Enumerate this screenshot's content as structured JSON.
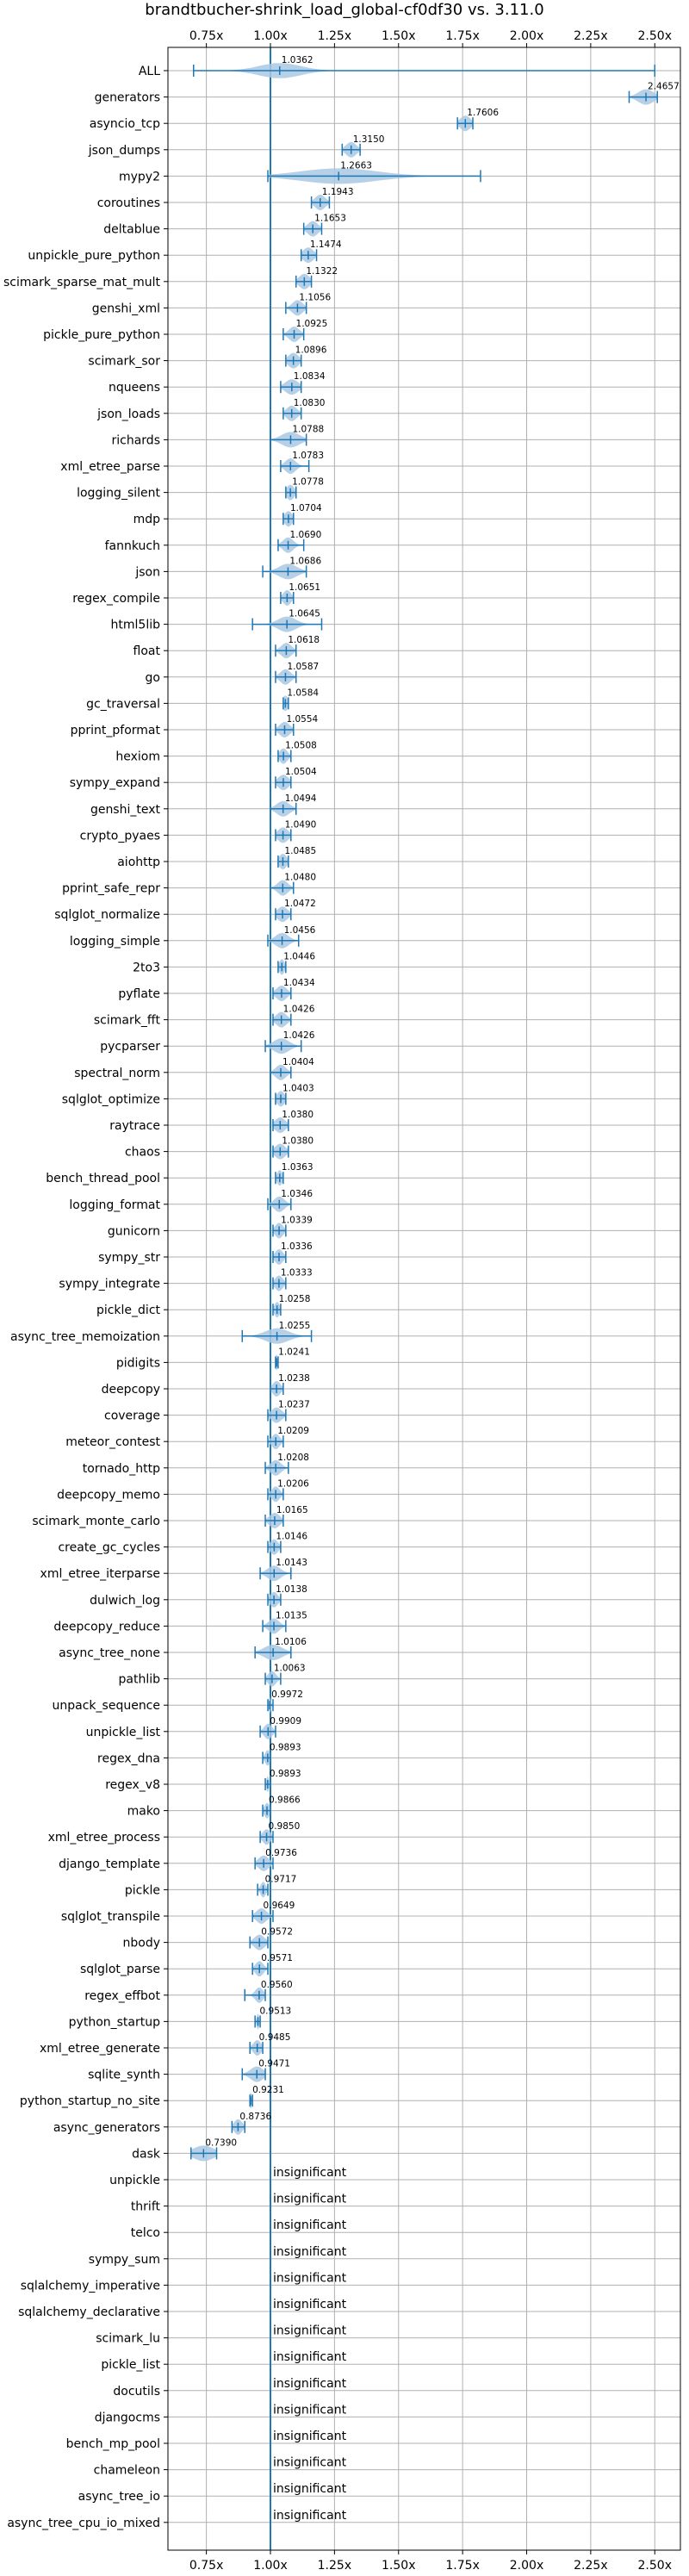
{
  "chart_data": {
    "type": "violin",
    "title": "brandtbucher-shrink_load_global-cf0df30 vs. 3.11.0",
    "xlabel": "",
    "ylabel": "",
    "xlim": [
      0.6,
      2.6
    ],
    "reference_x": 1.0,
    "xticks": [
      0.75,
      1.0,
      1.25,
      1.5,
      1.75,
      2.0,
      2.25,
      2.5
    ],
    "xtick_labels": [
      "0.75x",
      "1.00x",
      "1.25x",
      "1.50x",
      "1.75x",
      "2.00x",
      "2.25x",
      "2.50x"
    ],
    "grid": true,
    "colors": {
      "line": "#1f77b4",
      "violin": "#a9c9e3",
      "grid": "#b0b0b0"
    },
    "rows": [
      {
        "name": "ALL",
        "value": 1.0362,
        "value_label": "1.0362",
        "min": 0.7,
        "max": 2.5,
        "spread": 0.08
      },
      {
        "name": "generators",
        "value": 2.4657,
        "value_label": "2.4657",
        "min": 2.4,
        "max": 2.51,
        "spread": 0.03
      },
      {
        "name": "asyncio_tcp",
        "value": 1.7606,
        "value_label": "1.7606",
        "min": 1.73,
        "max": 1.79,
        "spread": 0.02
      },
      {
        "name": "json_dumps",
        "value": 1.315,
        "value_label": "1.3150",
        "min": 1.28,
        "max": 1.35,
        "spread": 0.02
      },
      {
        "name": "mypy2",
        "value": 1.2663,
        "value_label": "1.2663",
        "min": 0.99,
        "max": 1.82,
        "spread": 0.15
      },
      {
        "name": "coroutines",
        "value": 1.1943,
        "value_label": "1.1943",
        "min": 1.16,
        "max": 1.23,
        "spread": 0.02
      },
      {
        "name": "deltablue",
        "value": 1.1653,
        "value_label": "1.1653",
        "min": 1.13,
        "max": 1.2,
        "spread": 0.02
      },
      {
        "name": "unpickle_pure_python",
        "value": 1.1474,
        "value_label": "1.1474",
        "min": 1.12,
        "max": 1.18,
        "spread": 0.02
      },
      {
        "name": "scimark_sparse_mat_mult",
        "value": 1.1322,
        "value_label": "1.1322",
        "min": 1.1,
        "max": 1.16,
        "spread": 0.02
      },
      {
        "name": "genshi_xml",
        "value": 1.1056,
        "value_label": "1.1056",
        "min": 1.06,
        "max": 1.14,
        "spread": 0.02
      },
      {
        "name": "pickle_pure_python",
        "value": 1.0925,
        "value_label": "1.0925",
        "min": 1.05,
        "max": 1.13,
        "spread": 0.02
      },
      {
        "name": "scimark_sor",
        "value": 1.0896,
        "value_label": "1.0896",
        "min": 1.06,
        "max": 1.12,
        "spread": 0.02
      },
      {
        "name": "nqueens",
        "value": 1.0834,
        "value_label": "1.0834",
        "min": 1.04,
        "max": 1.12,
        "spread": 0.025
      },
      {
        "name": "json_loads",
        "value": 1.083,
        "value_label": "1.0830",
        "min": 1.05,
        "max": 1.12,
        "spread": 0.02
      },
      {
        "name": "richards",
        "value": 1.0788,
        "value_label": "1.0788",
        "min": 1.0,
        "max": 1.14,
        "spread": 0.035
      },
      {
        "name": "xml_etree_parse",
        "value": 1.0783,
        "value_label": "1.0783",
        "min": 1.04,
        "max": 1.15,
        "spread": 0.02
      },
      {
        "name": "logging_silent",
        "value": 1.0778,
        "value_label": "1.0778",
        "min": 1.06,
        "max": 1.1,
        "spread": 0.015
      },
      {
        "name": "mdp",
        "value": 1.0704,
        "value_label": "1.0704",
        "min": 1.05,
        "max": 1.09,
        "spread": 0.015
      },
      {
        "name": "fannkuch",
        "value": 1.069,
        "value_label": "1.0690",
        "min": 1.03,
        "max": 1.13,
        "spread": 0.02
      },
      {
        "name": "json",
        "value": 1.0686,
        "value_label": "1.0686",
        "min": 0.97,
        "max": 1.14,
        "spread": 0.035
      },
      {
        "name": "regex_compile",
        "value": 1.0651,
        "value_label": "1.0651",
        "min": 1.04,
        "max": 1.09,
        "spread": 0.015
      },
      {
        "name": "html5lib",
        "value": 1.0645,
        "value_label": "1.0645",
        "min": 0.93,
        "max": 1.2,
        "spread": 0.035
      },
      {
        "name": "float",
        "value": 1.0618,
        "value_label": "1.0618",
        "min": 1.02,
        "max": 1.1,
        "spread": 0.02
      },
      {
        "name": "go",
        "value": 1.0587,
        "value_label": "1.0587",
        "min": 1.02,
        "max": 1.1,
        "spread": 0.02
      },
      {
        "name": "gc_traversal",
        "value": 1.0584,
        "value_label": "1.0584",
        "min": 1.05,
        "max": 1.07,
        "spread": 0.01
      },
      {
        "name": "pprint_pformat",
        "value": 1.0554,
        "value_label": "1.0554",
        "min": 1.02,
        "max": 1.09,
        "spread": 0.02
      },
      {
        "name": "hexiom",
        "value": 1.0508,
        "value_label": "1.0508",
        "min": 1.03,
        "max": 1.08,
        "spread": 0.015
      },
      {
        "name": "sympy_expand",
        "value": 1.0504,
        "value_label": "1.0504",
        "min": 1.02,
        "max": 1.08,
        "spread": 0.02
      },
      {
        "name": "genshi_text",
        "value": 1.0494,
        "value_label": "1.0494",
        "min": 1.0,
        "max": 1.1,
        "spread": 0.025
      },
      {
        "name": "crypto_pyaes",
        "value": 1.049,
        "value_label": "1.0490",
        "min": 1.02,
        "max": 1.08,
        "spread": 0.02
      },
      {
        "name": "aiohttp",
        "value": 1.0485,
        "value_label": "1.0485",
        "min": 1.03,
        "max": 1.07,
        "spread": 0.015
      },
      {
        "name": "pprint_safe_repr",
        "value": 1.048,
        "value_label": "1.0480",
        "min": 1.0,
        "max": 1.09,
        "spread": 0.02
      },
      {
        "name": "sqlglot_normalize",
        "value": 1.0472,
        "value_label": "1.0472",
        "min": 1.02,
        "max": 1.08,
        "spread": 0.02
      },
      {
        "name": "logging_simple",
        "value": 1.0456,
        "value_label": "1.0456",
        "min": 0.99,
        "max": 1.11,
        "spread": 0.025
      },
      {
        "name": "2to3",
        "value": 1.0446,
        "value_label": "1.0446",
        "min": 1.03,
        "max": 1.06,
        "spread": 0.01
      },
      {
        "name": "pyflate",
        "value": 1.0434,
        "value_label": "1.0434",
        "min": 1.01,
        "max": 1.08,
        "spread": 0.02
      },
      {
        "name": "scimark_fft",
        "value": 1.0426,
        "value_label": "1.0426",
        "min": 1.01,
        "max": 1.08,
        "spread": 0.02
      },
      {
        "name": "pycparser",
        "value": 1.0426,
        "value_label": "1.0426",
        "min": 0.98,
        "max": 1.12,
        "spread": 0.03
      },
      {
        "name": "spectral_norm",
        "value": 1.0404,
        "value_label": "1.0404",
        "min": 1.0,
        "max": 1.08,
        "spread": 0.02
      },
      {
        "name": "sqlglot_optimize",
        "value": 1.0403,
        "value_label": "1.0403",
        "min": 1.02,
        "max": 1.06,
        "spread": 0.015
      },
      {
        "name": "raytrace",
        "value": 1.038,
        "value_label": "1.0380",
        "min": 1.01,
        "max": 1.07,
        "spread": 0.02
      },
      {
        "name": "chaos",
        "value": 1.038,
        "value_label": "1.0380",
        "min": 1.01,
        "max": 1.07,
        "spread": 0.02
      },
      {
        "name": "bench_thread_pool",
        "value": 1.0363,
        "value_label": "1.0363",
        "min": 1.02,
        "max": 1.05,
        "spread": 0.01
      },
      {
        "name": "logging_format",
        "value": 1.0346,
        "value_label": "1.0346",
        "min": 0.99,
        "max": 1.08,
        "spread": 0.02
      },
      {
        "name": "gunicorn",
        "value": 1.0339,
        "value_label": "1.0339",
        "min": 1.01,
        "max": 1.06,
        "spread": 0.015
      },
      {
        "name": "sympy_str",
        "value": 1.0336,
        "value_label": "1.0336",
        "min": 1.01,
        "max": 1.06,
        "spread": 0.015
      },
      {
        "name": "sympy_integrate",
        "value": 1.0333,
        "value_label": "1.0333",
        "min": 1.01,
        "max": 1.06,
        "spread": 0.015
      },
      {
        "name": "pickle_dict",
        "value": 1.0258,
        "value_label": "1.0258",
        "min": 1.01,
        "max": 1.04,
        "spread": 0.01
      },
      {
        "name": "async_tree_memoization",
        "value": 1.0255,
        "value_label": "1.0255",
        "min": 0.89,
        "max": 1.16,
        "spread": 0.045
      },
      {
        "name": "pidigits",
        "value": 1.0241,
        "value_label": "1.0241",
        "min": 1.02,
        "max": 1.03,
        "spread": 0.005
      },
      {
        "name": "deepcopy",
        "value": 1.0238,
        "value_label": "1.0238",
        "min": 1.0,
        "max": 1.05,
        "spread": 0.015
      },
      {
        "name": "coverage",
        "value": 1.0237,
        "value_label": "1.0237",
        "min": 0.99,
        "max": 1.06,
        "spread": 0.02
      },
      {
        "name": "meteor_contest",
        "value": 1.0209,
        "value_label": "1.0209",
        "min": 0.99,
        "max": 1.05,
        "spread": 0.015
      },
      {
        "name": "tornado_http",
        "value": 1.0208,
        "value_label": "1.0208",
        "min": 0.98,
        "max": 1.07,
        "spread": 0.02
      },
      {
        "name": "deepcopy_memo",
        "value": 1.0206,
        "value_label": "1.0206",
        "min": 0.99,
        "max": 1.05,
        "spread": 0.015
      },
      {
        "name": "scimark_monte_carlo",
        "value": 1.0165,
        "value_label": "1.0165",
        "min": 0.98,
        "max": 1.05,
        "spread": 0.02
      },
      {
        "name": "create_gc_cycles",
        "value": 1.0146,
        "value_label": "1.0146",
        "min": 0.99,
        "max": 1.04,
        "spread": 0.015
      },
      {
        "name": "xml_etree_iterparse",
        "value": 1.0143,
        "value_label": "1.0143",
        "min": 0.96,
        "max": 1.08,
        "spread": 0.025
      },
      {
        "name": "dulwich_log",
        "value": 1.0138,
        "value_label": "1.0138",
        "min": 0.99,
        "max": 1.04,
        "spread": 0.015
      },
      {
        "name": "deepcopy_reduce",
        "value": 1.0135,
        "value_label": "1.0135",
        "min": 0.97,
        "max": 1.06,
        "spread": 0.02
      },
      {
        "name": "async_tree_none",
        "value": 1.0106,
        "value_label": "1.0106",
        "min": 0.94,
        "max": 1.08,
        "spread": 0.035
      },
      {
        "name": "pathlib",
        "value": 1.0063,
        "value_label": "1.0063",
        "min": 0.98,
        "max": 1.04,
        "spread": 0.015
      },
      {
        "name": "unpack_sequence",
        "value": 0.9972,
        "value_label": "0.9972",
        "min": 0.99,
        "max": 1.01,
        "spread": 0.005
      },
      {
        "name": "unpickle_list",
        "value": 0.9909,
        "value_label": "0.9909",
        "min": 0.96,
        "max": 1.02,
        "spread": 0.015
      },
      {
        "name": "regex_dna",
        "value": 0.9893,
        "value_label": "0.9893",
        "min": 0.97,
        "max": 1.0,
        "spread": 0.01
      },
      {
        "name": "regex_v8",
        "value": 0.9893,
        "value_label": "0.9893",
        "min": 0.98,
        "max": 1.0,
        "spread": 0.005
      },
      {
        "name": "mako",
        "value": 0.9866,
        "value_label": "0.9866",
        "min": 0.97,
        "max": 1.0,
        "spread": 0.01
      },
      {
        "name": "xml_etree_process",
        "value": 0.985,
        "value_label": "0.9850",
        "min": 0.96,
        "max": 1.01,
        "spread": 0.015
      },
      {
        "name": "django_template",
        "value": 0.9736,
        "value_label": "0.9736",
        "min": 0.94,
        "max": 1.01,
        "spread": 0.02
      },
      {
        "name": "pickle",
        "value": 0.9717,
        "value_label": "0.9717",
        "min": 0.95,
        "max": 0.99,
        "spread": 0.01
      },
      {
        "name": "sqlglot_transpile",
        "value": 0.9649,
        "value_label": "0.9649",
        "min": 0.93,
        "max": 1.01,
        "spread": 0.02
      },
      {
        "name": "nbody",
        "value": 0.9572,
        "value_label": "0.9572",
        "min": 0.92,
        "max": 0.99,
        "spread": 0.02
      },
      {
        "name": "sqlglot_parse",
        "value": 0.9571,
        "value_label": "0.9571",
        "min": 0.93,
        "max": 0.99,
        "spread": 0.015
      },
      {
        "name": "regex_effbot",
        "value": 0.956,
        "value_label": "0.9560",
        "min": 0.9,
        "max": 0.98,
        "spread": 0.015
      },
      {
        "name": "python_startup",
        "value": 0.9513,
        "value_label": "0.9513",
        "min": 0.94,
        "max": 0.96,
        "spread": 0.005
      },
      {
        "name": "xml_etree_generate",
        "value": 0.9485,
        "value_label": "0.9485",
        "min": 0.92,
        "max": 0.97,
        "spread": 0.015
      },
      {
        "name": "sqlite_synth",
        "value": 0.9471,
        "value_label": "0.9471",
        "min": 0.89,
        "max": 0.98,
        "spread": 0.025
      },
      {
        "name": "python_startup_no_site",
        "value": 0.9231,
        "value_label": "0.9231",
        "min": 0.92,
        "max": 0.93,
        "spread": 0.005
      },
      {
        "name": "async_generators",
        "value": 0.8736,
        "value_label": "0.8736",
        "min": 0.85,
        "max": 0.9,
        "spread": 0.015
      },
      {
        "name": "dask",
        "value": 0.739,
        "value_label": "0.7390",
        "min": 0.69,
        "max": 0.79,
        "spread": 0.04
      },
      {
        "name": "unpickle",
        "insignificant": true
      },
      {
        "name": "thrift",
        "insignificant": true
      },
      {
        "name": "telco",
        "insignificant": true
      },
      {
        "name": "sympy_sum",
        "insignificant": true
      },
      {
        "name": "sqlalchemy_imperative",
        "insignificant": true
      },
      {
        "name": "sqlalchemy_declarative",
        "insignificant": true
      },
      {
        "name": "scimark_lu",
        "insignificant": true
      },
      {
        "name": "pickle_list",
        "insignificant": true
      },
      {
        "name": "docutils",
        "insignificant": true
      },
      {
        "name": "djangocms",
        "insignificant": true
      },
      {
        "name": "bench_mp_pool",
        "insignificant": true
      },
      {
        "name": "chameleon",
        "insignificant": true
      },
      {
        "name": "async_tree_io",
        "insignificant": true
      },
      {
        "name": "async_tree_cpu_io_mixed",
        "insignificant": true
      }
    ],
    "insignificant_label": "insignificant"
  }
}
